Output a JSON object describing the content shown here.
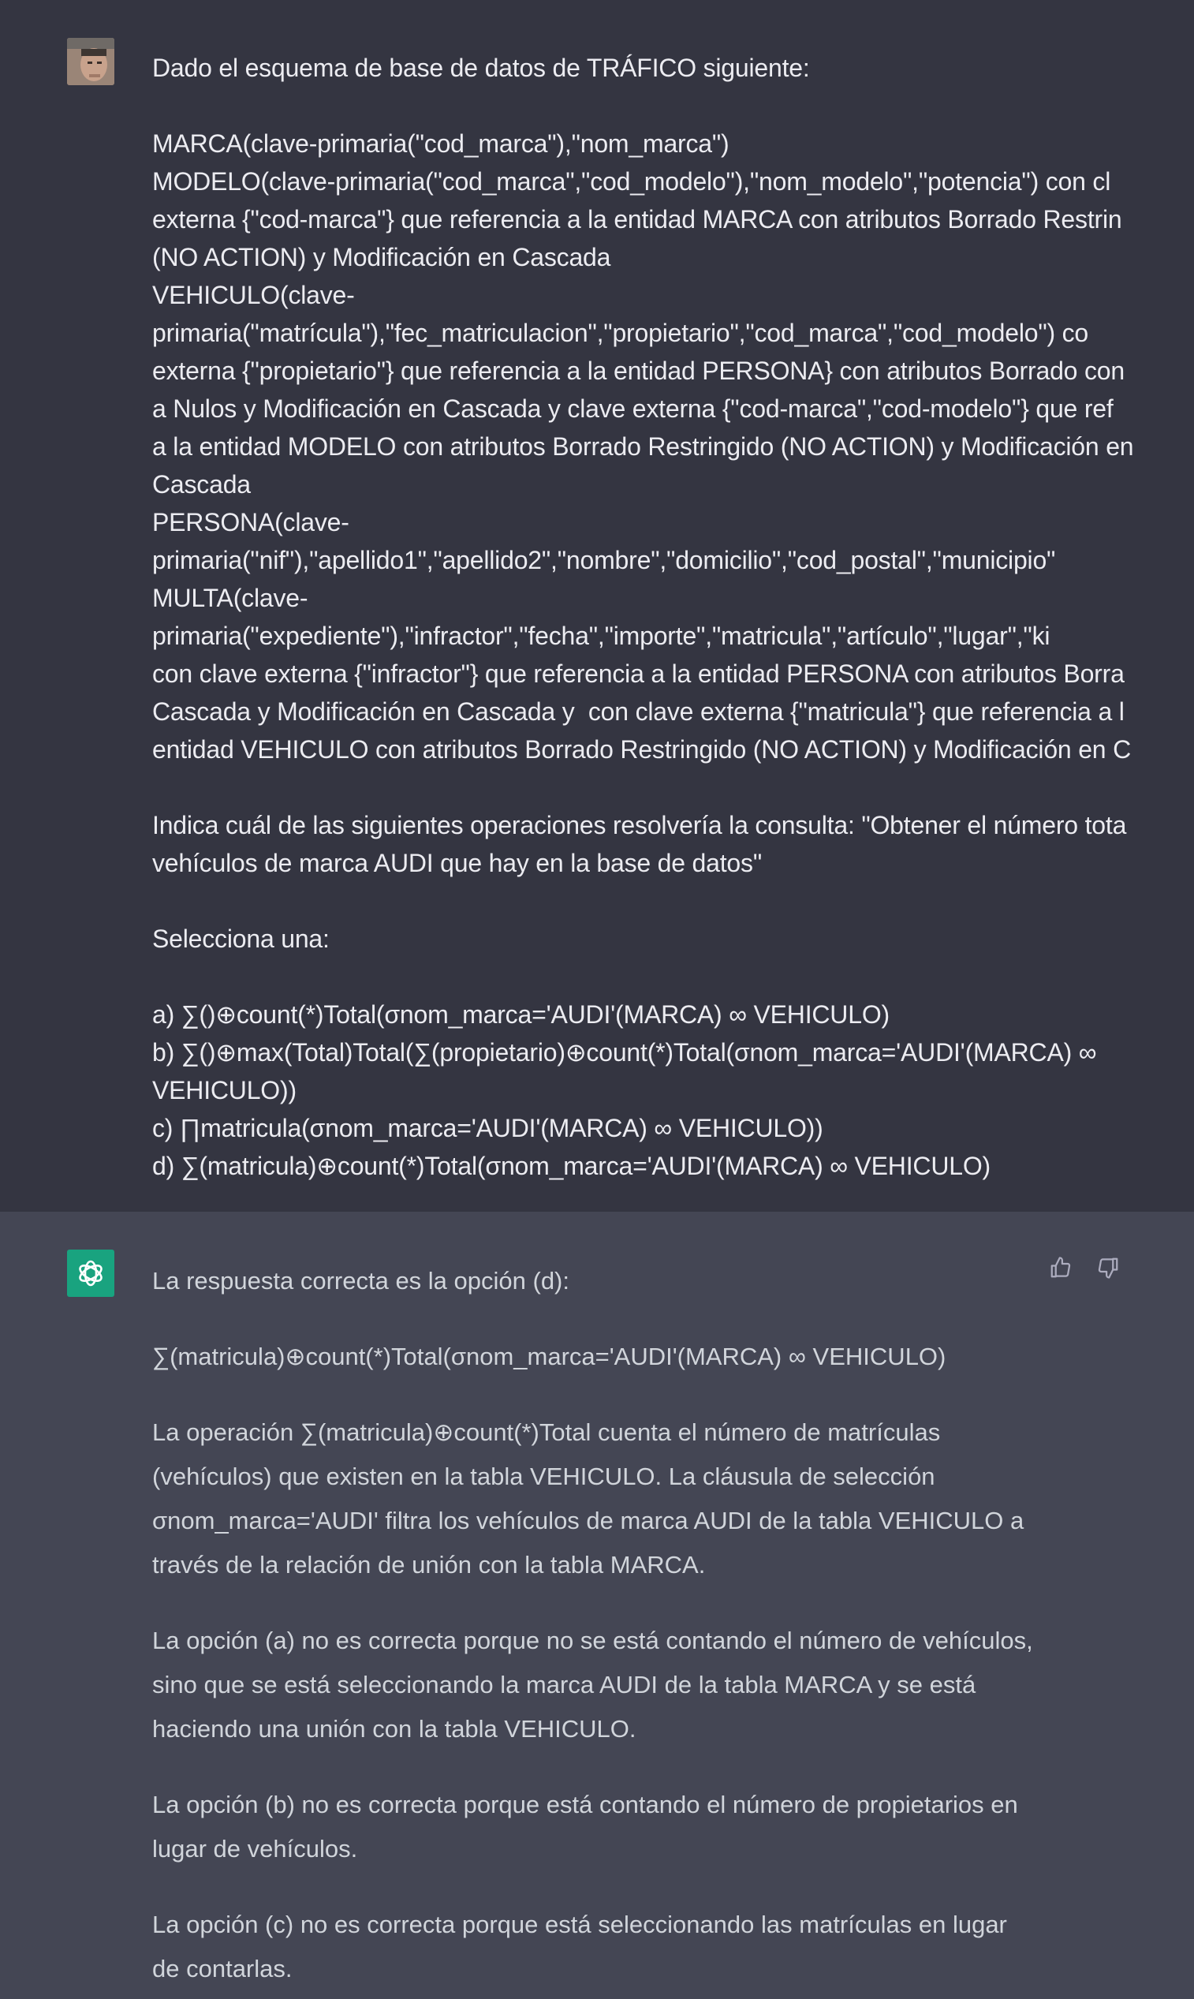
{
  "user_message": {
    "lines": [
      "Dado el esquema de base de datos de TRÁFICO siguiente:",
      "",
      "MARCA(clave-primaria(\"cod_marca\"),\"nom_marca\")",
      "MODELO(clave-primaria(\"cod_marca\",\"cod_modelo\"),\"nom_modelo\",\"potencia\") con cl",
      "externa {\"cod-marca\"} que referencia a la entidad MARCA con atributos Borrado Restrin",
      "(NO ACTION) y Modificación en Cascada",
      "VEHICULO(clave-",
      "primaria(\"matrícula\"),\"fec_matriculacion\",\"propietario\",\"cod_marca\",\"cod_modelo\") co",
      "externa {\"propietario\"} que referencia a la entidad PERSONA} con atributos Borrado con",
      "a Nulos y Modificación en Cascada y clave externa {\"cod-marca\",\"cod-modelo\"} que ref",
      "a la entidad MODELO con atributos Borrado Restringido (NO ACTION) y Modificación en",
      "Cascada",
      "PERSONA(clave-",
      "primaria(\"nif\"),\"apellido1\",\"apellido2\",\"nombre\",\"domicilio\",\"cod_postal\",\"municipio\"",
      "MULTA(clave-",
      "primaria(\"expediente\"),\"infractor\",\"fecha\",\"importe\",\"matricula\",\"artículo\",\"lugar\",\"ki",
      "con clave externa {\"infractor\"} que referencia a la entidad PERSONA con atributos Borra",
      "Cascada y Modificación en Cascada y  con clave externa {\"matricula\"} que referencia a l",
      "entidad VEHICULO con atributos Borrado Restringido (NO ACTION) y Modificación en C",
      "",
      "Indica cuál de las siguientes operaciones resolvería la consulta: \"Obtener el número tota",
      "vehículos de marca AUDI que hay en la base de datos\"",
      "",
      "Selecciona una:",
      "",
      "a) ∑()⊕count(*)Total(σnom_marca='AUDI'(MARCA) ∞ VEHICULO)",
      "b) ∑()⊕max(Total)Total(∑(propietario)⊕count(*)Total(σnom_marca='AUDI'(MARCA) ∞",
      "VEHICULO))",
      "c) ∏matricula(σnom_marca='AUDI'(MARCA) ∞ VEHICULO))",
      "d) ∑(matricula)⊕count(*)Total(σnom_marca='AUDI'(MARCA) ∞ VEHICULO)"
    ]
  },
  "assistant_message": {
    "paragraphs": [
      "La respuesta correcta es la opción (d):",
      "∑(matricula)⊕count(*)Total(σnom_marca='AUDI'(MARCA) ∞ VEHICULO)",
      "La operación ∑(matricula)⊕count(*)Total cuenta el número de matrículas (vehículos) que existen en la tabla VEHICULO. La cláusula de selección σnom_marca='AUDI' filtra los vehículos de marca AUDI de la tabla VEHICULO a través de la relación de unión con la tabla MARCA.",
      "La opción (a) no es correcta porque no se está contando el número de vehículos, sino que se está seleccionando la marca AUDI de la tabla MARCA y se está haciendo una unión con la tabla VEHICULO.",
      "La opción (b) no es correcta porque está contando el número de propietarios en lugar de vehículos.",
      "La opción (c) no es correcta porque está seleccionando las matrículas en lugar de contarlas."
    ]
  },
  "icons": {
    "user_avatar": "user-avatar-photo",
    "assistant_avatar": "openai-logo-icon",
    "thumbs_up": "thumbs-up-icon",
    "thumbs_down": "thumbs-down-icon"
  },
  "colors": {
    "user_bg": "#343541",
    "assistant_bg": "#444654",
    "user_text": "#ececf1",
    "assistant_text": "#d1d5db",
    "assistant_avatar_bg": "#19a37f"
  }
}
